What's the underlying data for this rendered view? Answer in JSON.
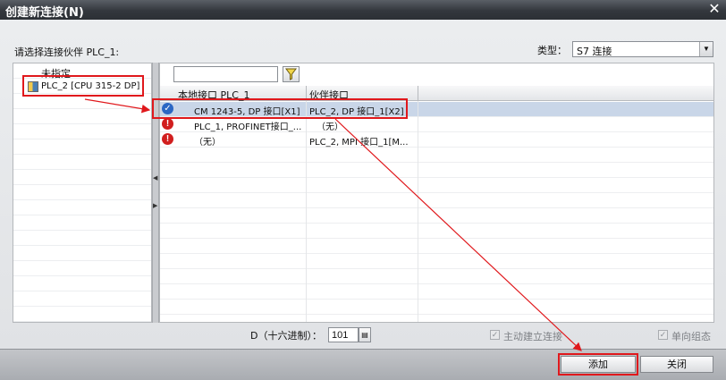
{
  "window": {
    "title": "创建新连接(N)",
    "close_glyph": "✕"
  },
  "prompt": "请选择连接伙伴 PLC_1:",
  "type_selector": {
    "label": "类型：",
    "value": "S7 连接"
  },
  "tree": {
    "items": [
      {
        "label": "未指定"
      },
      {
        "label": "PLC_2 [CPU 315-2 DP]",
        "icon": "plc-device-icon"
      }
    ]
  },
  "filter": {
    "value": "",
    "icon": "filter-funnel-icon"
  },
  "grid": {
    "headers": {
      "local": "本地接口 PLC_1",
      "partner": "伙伴接口"
    },
    "rows": [
      {
        "status": "ok",
        "local": "CM 1243-5, DP 接口[X1]",
        "partner": "PLC_2, DP 接口_1[X2]",
        "selected": true
      },
      {
        "status": "error",
        "local": "PLC_1, PROFINET接口_...",
        "partner": "（无）",
        "selected": false
      },
      {
        "status": "error",
        "local": "（无）",
        "partner": "PLC_2, MPI 接口_1[M...",
        "selected": false
      }
    ]
  },
  "address": {
    "label": "D（十六进制）：",
    "value": "101"
  },
  "options": {
    "active_connect": {
      "label": "主动建立连接",
      "checked": true,
      "enabled": false
    },
    "one_way": {
      "label": "单向组态",
      "checked": true,
      "enabled": false
    }
  },
  "buttons": {
    "add": "添加",
    "close": "关闭"
  },
  "colors": {
    "annotation": "#e0181c",
    "selection": "#c9d6e8",
    "titlebar": "#33373d"
  }
}
